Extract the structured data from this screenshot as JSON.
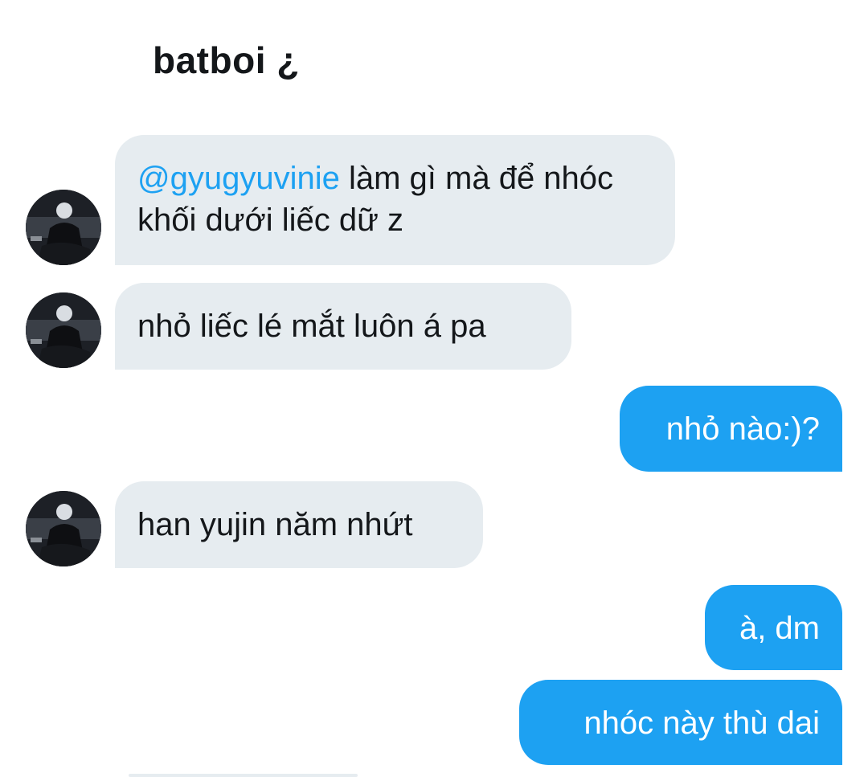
{
  "header": {
    "title": "batboi ¿"
  },
  "messages": [
    {
      "sender": "other",
      "mention": "@gyugyuvinie",
      "text": " làm gì mà để nhóc khối dưới liếc dữ z"
    },
    {
      "sender": "other",
      "text": "nhỏ liếc lé mắt luôn á pa"
    },
    {
      "sender": "me",
      "text": "nhỏ nào:)?"
    },
    {
      "sender": "other",
      "text": "han yujin năm nhứt"
    },
    {
      "sender": "me",
      "text": "à, dm"
    },
    {
      "sender": "me",
      "text": "nhóc này thù dai"
    }
  ],
  "colors": {
    "incoming_bubble": "#e6ecf0",
    "outgoing_bubble": "#1da1f2",
    "mention": "#1da1f2",
    "text": "#14171a"
  },
  "icons": {
    "avatar": "user-photo-avatar"
  }
}
